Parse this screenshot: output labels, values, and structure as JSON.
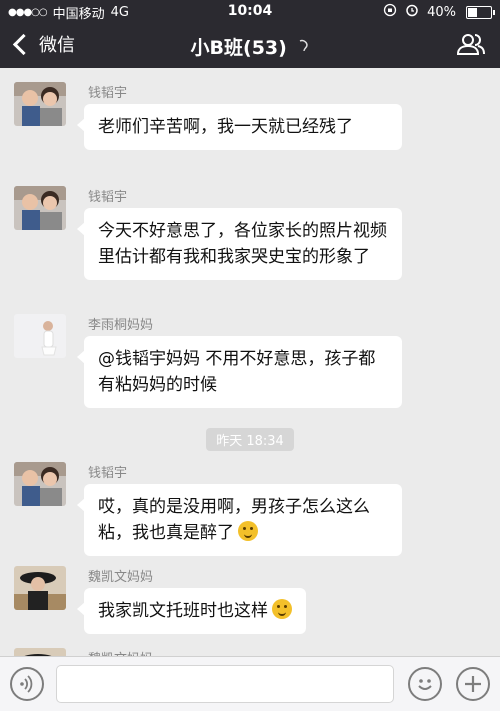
{
  "status": {
    "carrier": "中国移动",
    "network": "4G",
    "time": "10:04",
    "battery": "40%",
    "battery_level": 0.4
  },
  "nav": {
    "back_label": "微信",
    "title": "小B班(53)"
  },
  "messages": [
    {
      "sender": "钱韬宇",
      "text": "老师们辛苦啊，我一天就已经残了"
    },
    {
      "sender": "钱韬宇",
      "text": "今天不好意思了，各位家长的照片视频里估计都有我和我家哭史宝的形象了"
    },
    {
      "sender": "李雨桐妈妈",
      "text": "@钱韬宇妈妈 不用不好意思，孩子都有粘妈妈的时候"
    },
    {
      "sender": "钱韬宇",
      "text": "哎，真的是没用啊，男孩子怎么这么粘，我也真是醉了"
    },
    {
      "sender": "魏凯文妈妈",
      "text": "我家凯文托班时也这样"
    },
    {
      "sender": "魏凯文妈妈",
      "text": ""
    }
  ],
  "timestamp": "昨天 18:34",
  "colors": {
    "header_bg": "#2b2a30",
    "chat_bg": "#ebebeb",
    "bubble_bg": "#ffffff",
    "timestamp_bg": "#d6d6d6"
  }
}
